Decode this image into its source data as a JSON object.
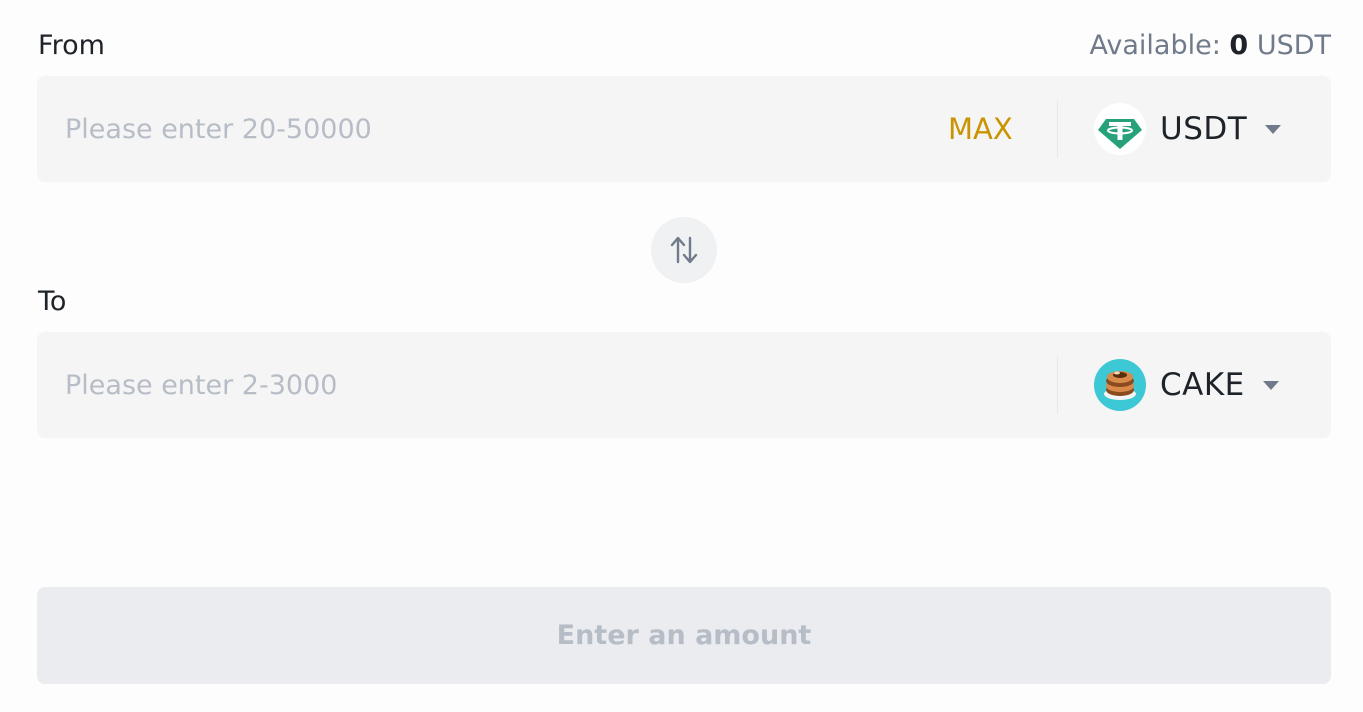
{
  "from": {
    "label": "From",
    "available_prefix": "Available:",
    "available_amount": "0",
    "available_unit": "USDT",
    "placeholder": "Please enter 20-50000",
    "max_label": "MAX",
    "token": {
      "name": "USDT",
      "icon": "tether-logo-icon",
      "color": "#26a17b"
    }
  },
  "to": {
    "label": "To",
    "placeholder": "Please enter 2-3000",
    "token": {
      "name": "CAKE",
      "icon": "pancakeswap-logo-icon",
      "color": "#3cc8d4"
    }
  },
  "swap": {
    "icon": "swap-arrows-icon"
  },
  "submit": {
    "label": "Enter an amount"
  },
  "colors": {
    "accent": "#c99400",
    "text": "#1e2329",
    "muted": "#707a8a",
    "placeholder": "#b7bdc6",
    "field_bg": "#f5f5f5"
  }
}
